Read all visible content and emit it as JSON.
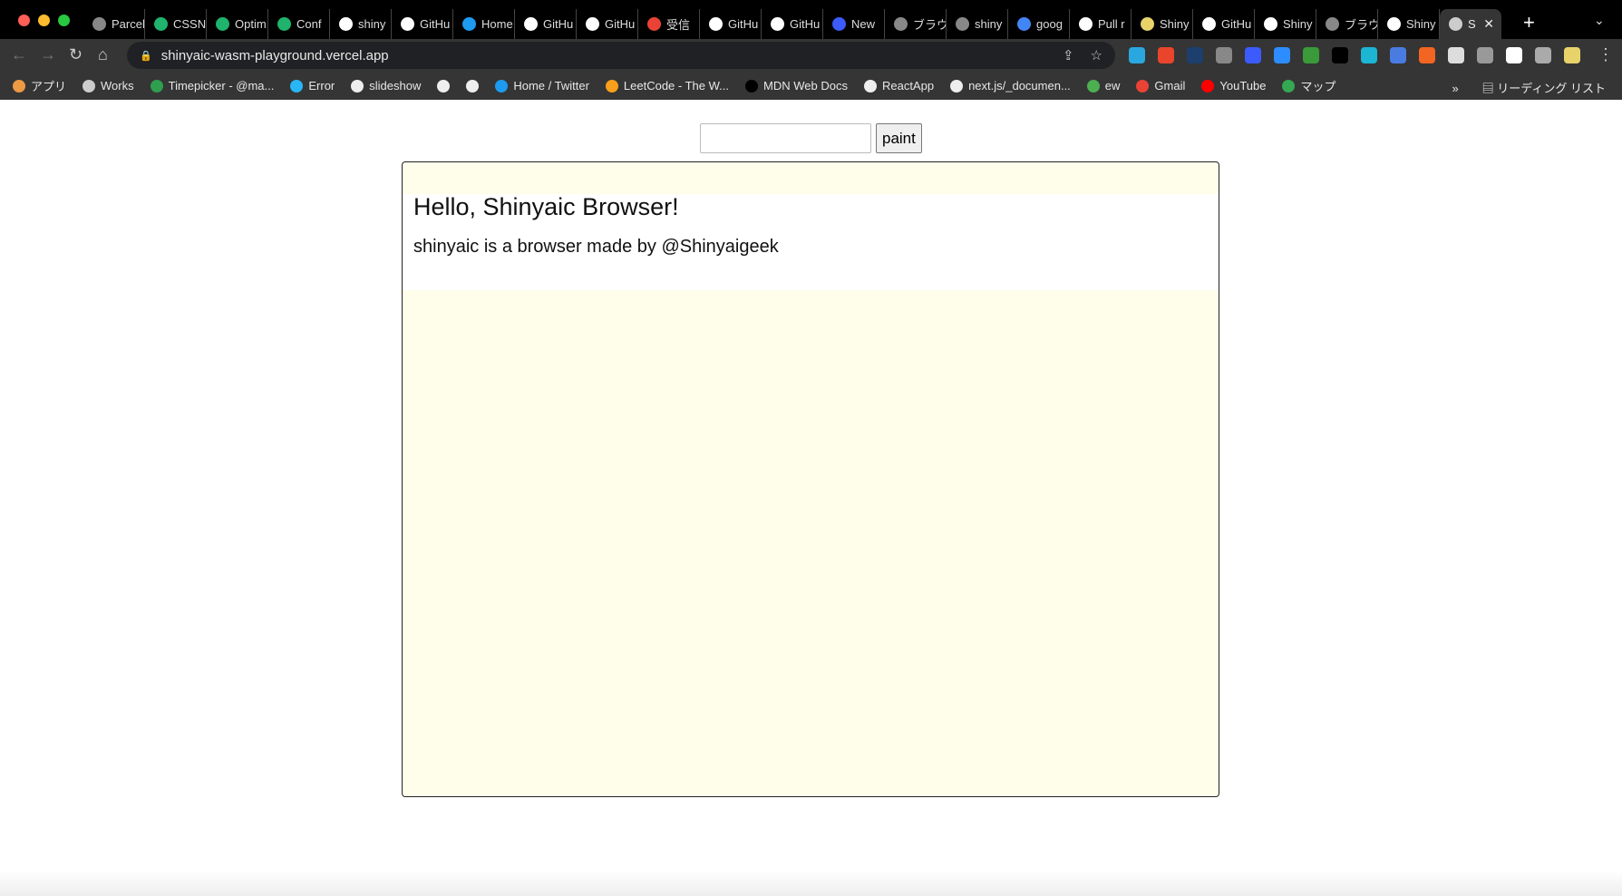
{
  "browser": {
    "tabs": [
      {
        "label": "Parcel",
        "icon": "globe-icon",
        "color": "#888"
      },
      {
        "label": "CSSN",
        "icon": "hexagon-icon",
        "color": "#1fb36c"
      },
      {
        "label": "Optim",
        "icon": "hexagon-icon",
        "color": "#1fb36c"
      },
      {
        "label": "Conf",
        "icon": "hexagon-icon",
        "color": "#1fb36c"
      },
      {
        "label": "shiny",
        "icon": "github-icon",
        "color": "#fff"
      },
      {
        "label": "GitHu",
        "icon": "github-icon",
        "color": "#fff"
      },
      {
        "label": "Home",
        "icon": "twitter-icon",
        "color": "#1d9bf0"
      },
      {
        "label": "GitHu",
        "icon": "github-icon",
        "color": "#fff"
      },
      {
        "label": "GitHu",
        "icon": "github-icon",
        "color": "#fff"
      },
      {
        "label": "受信",
        "icon": "gmail-icon",
        "color": "#ea4335"
      },
      {
        "label": "GitHu",
        "icon": "github-icon",
        "color": "#fff"
      },
      {
        "label": "GitHu",
        "icon": "github-icon",
        "color": "#fff"
      },
      {
        "label": "New",
        "icon": "app-icon",
        "color": "#3b5bfd"
      },
      {
        "label": "ブラウ",
        "icon": "globe-icon",
        "color": "#888"
      },
      {
        "label": "shiny",
        "icon": "globe-icon",
        "color": "#888"
      },
      {
        "label": "goog",
        "icon": "google-icon",
        "color": "#4285f4"
      },
      {
        "label": "Pull r",
        "icon": "github-icon",
        "color": "#fff"
      },
      {
        "label": "Shiny",
        "icon": "avatar-icon",
        "color": "#e8d36a"
      },
      {
        "label": "GitHu",
        "icon": "github-icon",
        "color": "#fff"
      },
      {
        "label": "Shiny",
        "icon": "github-icon",
        "color": "#fff"
      },
      {
        "label": "ブラウ",
        "icon": "globe-icon",
        "color": "#888"
      },
      {
        "label": "Shiny",
        "icon": "github-icon",
        "color": "#fff"
      },
      {
        "label": "S",
        "icon": "app-icon",
        "color": "#ccc",
        "active": true
      }
    ],
    "new_tab": "+",
    "url": "shinyaic-wasm-playground.vercel.app",
    "extension_colors": [
      "#2aa7df",
      "#e8452c",
      "#1c3f6e",
      "#888",
      "#3b5bfd",
      "#2d8cff",
      "#3a9a3a",
      "#000",
      "#1cb5d4",
      "#4a7be0",
      "#f26522",
      "#ddd",
      "#999",
      "#fff",
      "#aaa",
      "#e8d36a"
    ],
    "bookmarks": [
      {
        "label": "アプリ",
        "icon": "apps-icon",
        "color": "#e94"
      },
      {
        "label": "Works",
        "icon": "folder-icon",
        "color": "#ccc"
      },
      {
        "label": "Timepicker - @ma...",
        "icon": "timepicker-icon",
        "color": "#2e9e4f"
      },
      {
        "label": "Error",
        "icon": "c-icon",
        "color": "#29b6f6"
      },
      {
        "label": "slideshow",
        "icon": "globe-icon",
        "color": "#eee"
      },
      {
        "label": "",
        "icon": "github-icon",
        "color": "#eee"
      },
      {
        "label": "",
        "icon": "globe-icon",
        "color": "#eee"
      },
      {
        "label": "Home / Twitter",
        "icon": "twitter-icon",
        "color": "#1d9bf0"
      },
      {
        "label": "LeetCode - The W...",
        "icon": "leetcode-icon",
        "color": "#f89f1b"
      },
      {
        "label": "MDN Web Docs",
        "icon": "mdn-icon",
        "color": "#000"
      },
      {
        "label": "ReactApp",
        "icon": "globe-icon",
        "color": "#eee"
      },
      {
        "label": "next.js/_documen...",
        "icon": "github-icon",
        "color": "#eee"
      },
      {
        "label": "ew",
        "icon": "mongodb-icon",
        "color": "#4caf50"
      },
      {
        "label": "Gmail",
        "icon": "gmail-icon",
        "color": "#ea4335"
      },
      {
        "label": "YouTube",
        "icon": "youtube-icon",
        "color": "#ff0000"
      },
      {
        "label": "マップ",
        "icon": "maps-icon",
        "color": "#34a853"
      }
    ],
    "more_bookmarks": "»",
    "reading_list": "リーディング リスト"
  },
  "page": {
    "url_input": "",
    "paint_button": "paint",
    "canvas": {
      "heading": "Hello, Shinyaic Browser!",
      "paragraph": "shinyaic is a browser made by @Shinyaigeek",
      "background": "#fffeeb"
    }
  }
}
